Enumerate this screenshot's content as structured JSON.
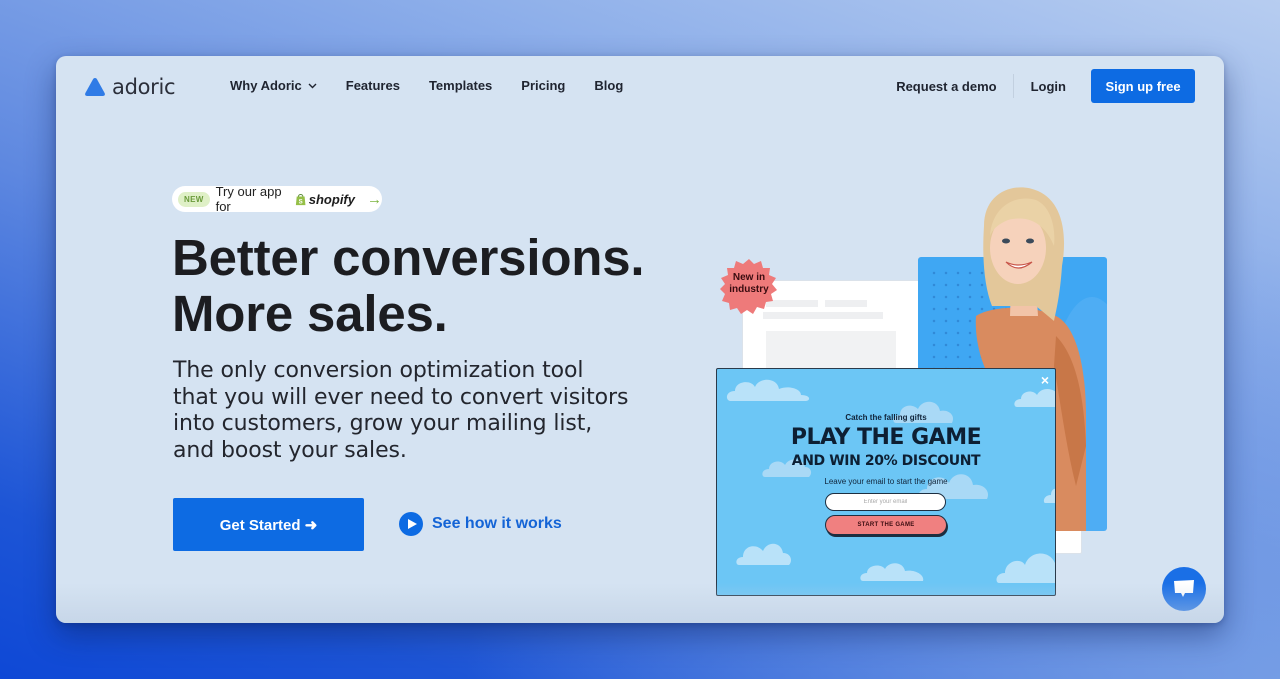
{
  "brand": {
    "name": "adoric",
    "accent_color": "#0d6be3"
  },
  "nav": {
    "links": [
      {
        "label": "Why Adoric",
        "has_dropdown": true
      },
      {
        "label": "Features"
      },
      {
        "label": "Templates"
      },
      {
        "label": "Pricing"
      },
      {
        "label": "Blog"
      }
    ],
    "request_demo": "Request a demo",
    "login": "Login",
    "signup": "Sign up free"
  },
  "hero": {
    "pill": {
      "badge": "NEW",
      "text": "Try our app for",
      "platform": "shopify",
      "arrow_icon": "arrow-right-icon"
    },
    "headline_line1": "Better conversions.",
    "headline_line2": "More sales.",
    "subtext": "The only conversion optimization tool that you will ever need to convert visitors into customers, grow your mailing list, and boost your sales.",
    "cta_label": "Get Started ➜",
    "secondary_label": "See how it works"
  },
  "illustration": {
    "badge_line1": "New in",
    "badge_line2": "industry",
    "popup": {
      "kicker": "Catch the falling gifts",
      "title": "PLAY THE GAME",
      "subtitle": "AND WIN 20% DISCOUNT",
      "instruction": "Leave your email to start the game",
      "email_placeholder": "Enter your email",
      "button_label": "START THE GAME",
      "close_symbol": "×"
    }
  },
  "chat": {
    "icon": "chat-bubble-icon"
  }
}
